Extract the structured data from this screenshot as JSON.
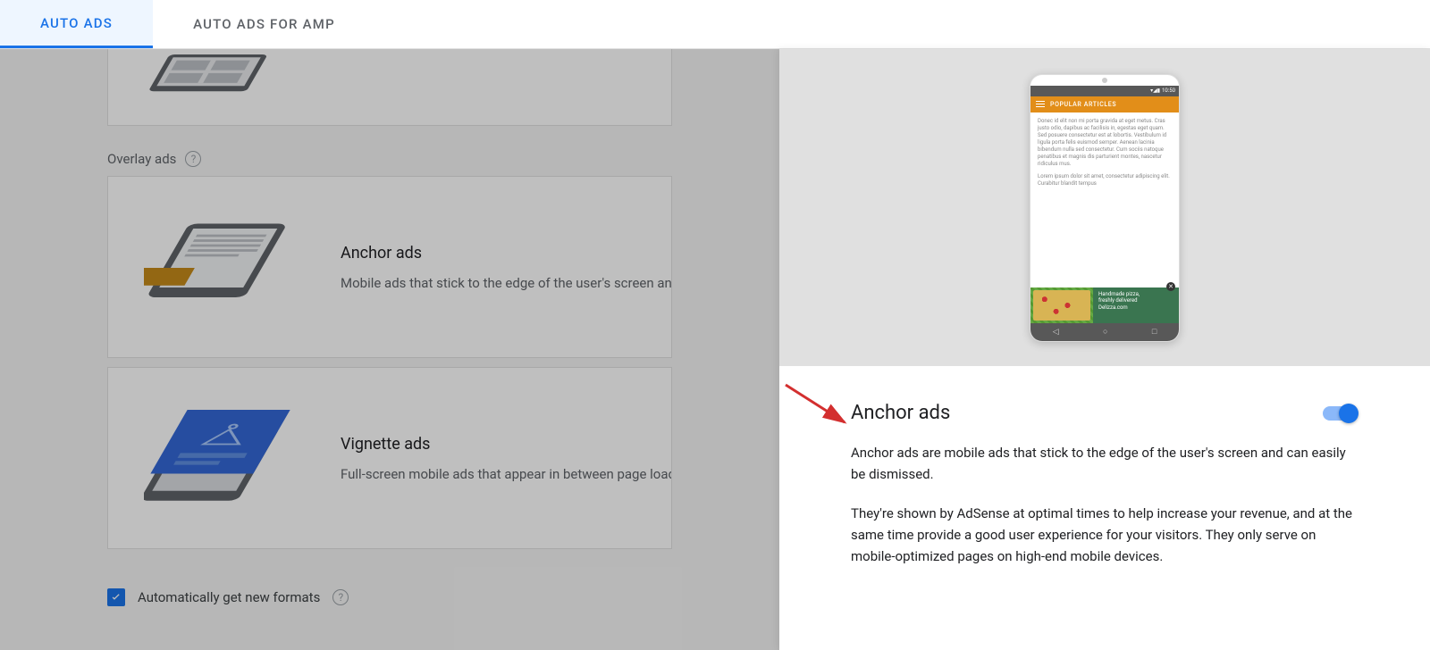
{
  "tabs": [
    {
      "label": "AUTO ADS",
      "active": true
    },
    {
      "label": "AUTO ADS FOR AMP",
      "active": false
    }
  ],
  "overlay_section": {
    "header": "Overlay ads",
    "cards": [
      {
        "title": "Anchor ads",
        "desc": "Mobile ads that stick to the edge of the user's screen and"
      },
      {
        "title": "Vignette ads",
        "desc": "Full-screen mobile ads that appear in between page loads"
      }
    ]
  },
  "footer": {
    "checkbox_label": "Automatically get new formats"
  },
  "side_panel": {
    "title": "Anchor ads",
    "toggle_on": true,
    "para1": "Anchor ads are mobile ads that stick to the edge of the user's screen and can easily be dismissed.",
    "para2": "They're shown by AdSense at optimal times to help increase your revenue, and at the same time provide a good user experience for your visitors. They only serve on mobile-optimized pages on high-end mobile devices."
  },
  "phone_mock": {
    "status_time": "10:50",
    "header": "POPULAR ARTICLES",
    "body1": "Donec id elit non mi porta gravida at eget metus. Cras justo odio, dapibus ac facilisis in, egestas eget quam. Sed posuere consectetur est at lobortis. Vestibulum id ligula porta felis euismod semper. Aenean lacinia bibendum nulla sed consectetur. Cum sociis natoque penatibus et magnis dis parturient montes, nascetur ridiculus mus.",
    "body2": "Lorem ipsum dolor sit amet, consectetur adipiscing elit. Curabitur blandit tempus",
    "ad_line1": "Handmade pizza,",
    "ad_line2": "freshly delivered",
    "ad_line3": "Delizza.com"
  },
  "icons": {
    "help": "?",
    "check": "✓"
  }
}
